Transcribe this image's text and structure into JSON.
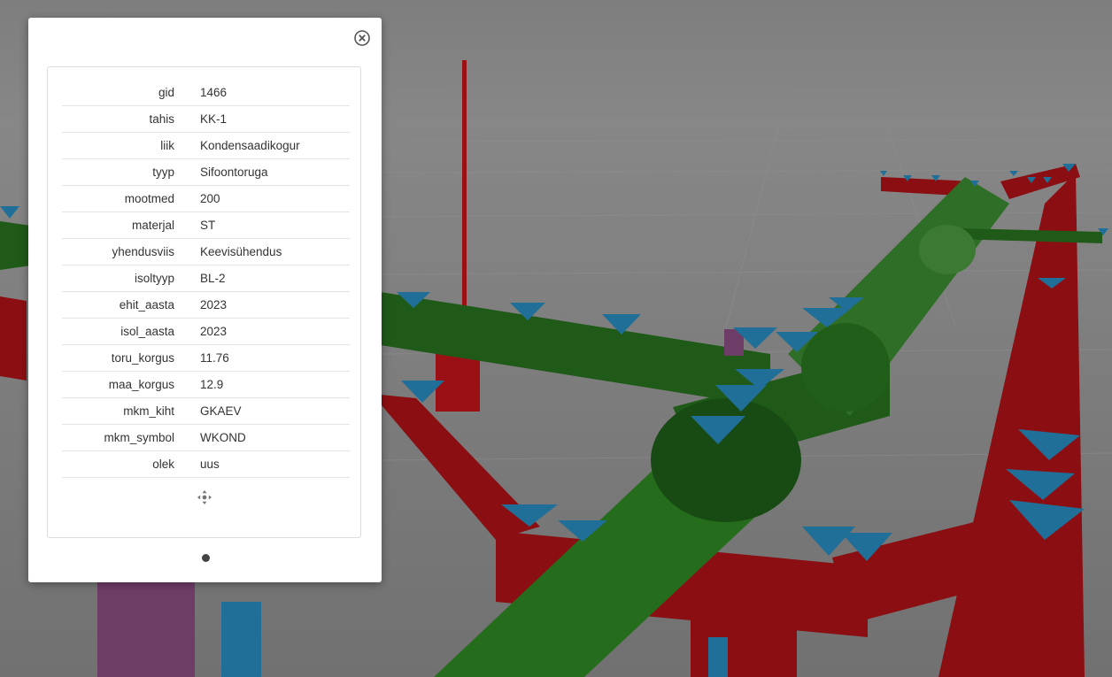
{
  "popup": {
    "close_icon": "close-circle-icon",
    "move_icon": "move-arrows-icon",
    "pager": {
      "current": 1,
      "total": 1
    },
    "attributes": [
      {
        "key": "gid",
        "value": "1466"
      },
      {
        "key": "tahis",
        "value": "KK-1"
      },
      {
        "key": "liik",
        "value": "Kondensaadikogur"
      },
      {
        "key": "tyyp",
        "value": "Sifoontoruga"
      },
      {
        "key": "mootmed",
        "value": "200"
      },
      {
        "key": "materjal",
        "value": "ST"
      },
      {
        "key": "yhendusviis",
        "value": "Keevisühendus"
      },
      {
        "key": "isoltyyp",
        "value": "BL-2"
      },
      {
        "key": "ehit_aasta",
        "value": "2023"
      },
      {
        "key": "isol_aasta",
        "value": "2023"
      },
      {
        "key": "toru_korgus",
        "value": "11.76"
      },
      {
        "key": "maa_korgus",
        "value": "12.9"
      },
      {
        "key": "mkm_kiht",
        "value": "GKAEV"
      },
      {
        "key": "mkm_symbol",
        "value": "WKOND"
      },
      {
        "key": "olek",
        "value": "uus"
      }
    ]
  },
  "colors": {
    "pipe_red": "#8b0f12",
    "pipe_green": "#1f5a18",
    "marker_blue": "#1f6f98",
    "purple": "#6d3d67",
    "ground": "#7d7d7d"
  }
}
